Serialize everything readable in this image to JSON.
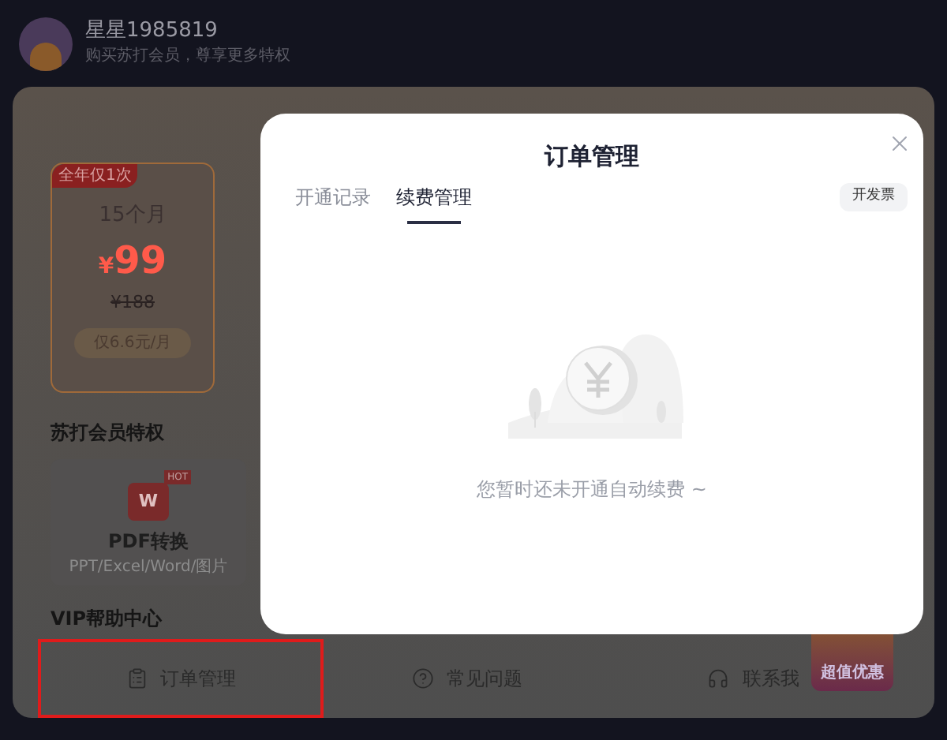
{
  "user": {
    "name": "星星1985819",
    "subtitle": "购买苏打会员，尊享更多特权"
  },
  "plan": {
    "tag": "全年仅1次",
    "duration": "15个月",
    "currency": "¥",
    "price": "99",
    "original_price": "¥188",
    "monthly": "仅6.6元/月"
  },
  "privileges": {
    "title": "苏打会员特权",
    "items": [
      {
        "badge": "HOT",
        "icon_letter": "W",
        "name": "PDF转换",
        "desc": "PPT/Excel/Word/图片"
      }
    ]
  },
  "help": {
    "title": "VIP帮助中心",
    "items": [
      {
        "kind": "orders",
        "label": "订单管理",
        "highlighted": true
      },
      {
        "kind": "faq",
        "label": "常见问题",
        "highlighted": false
      },
      {
        "kind": "contact",
        "label": "联系我",
        "highlighted": false
      }
    ]
  },
  "promo": {
    "label": "超值优惠"
  },
  "modal": {
    "title": "订单管理",
    "tabs": [
      {
        "label": "开通记录",
        "selected": false
      },
      {
        "label": "续费管理",
        "selected": true
      }
    ],
    "invoice_button": "开发票",
    "empty_message": "您暂时还未开通自动续费 ~"
  }
}
